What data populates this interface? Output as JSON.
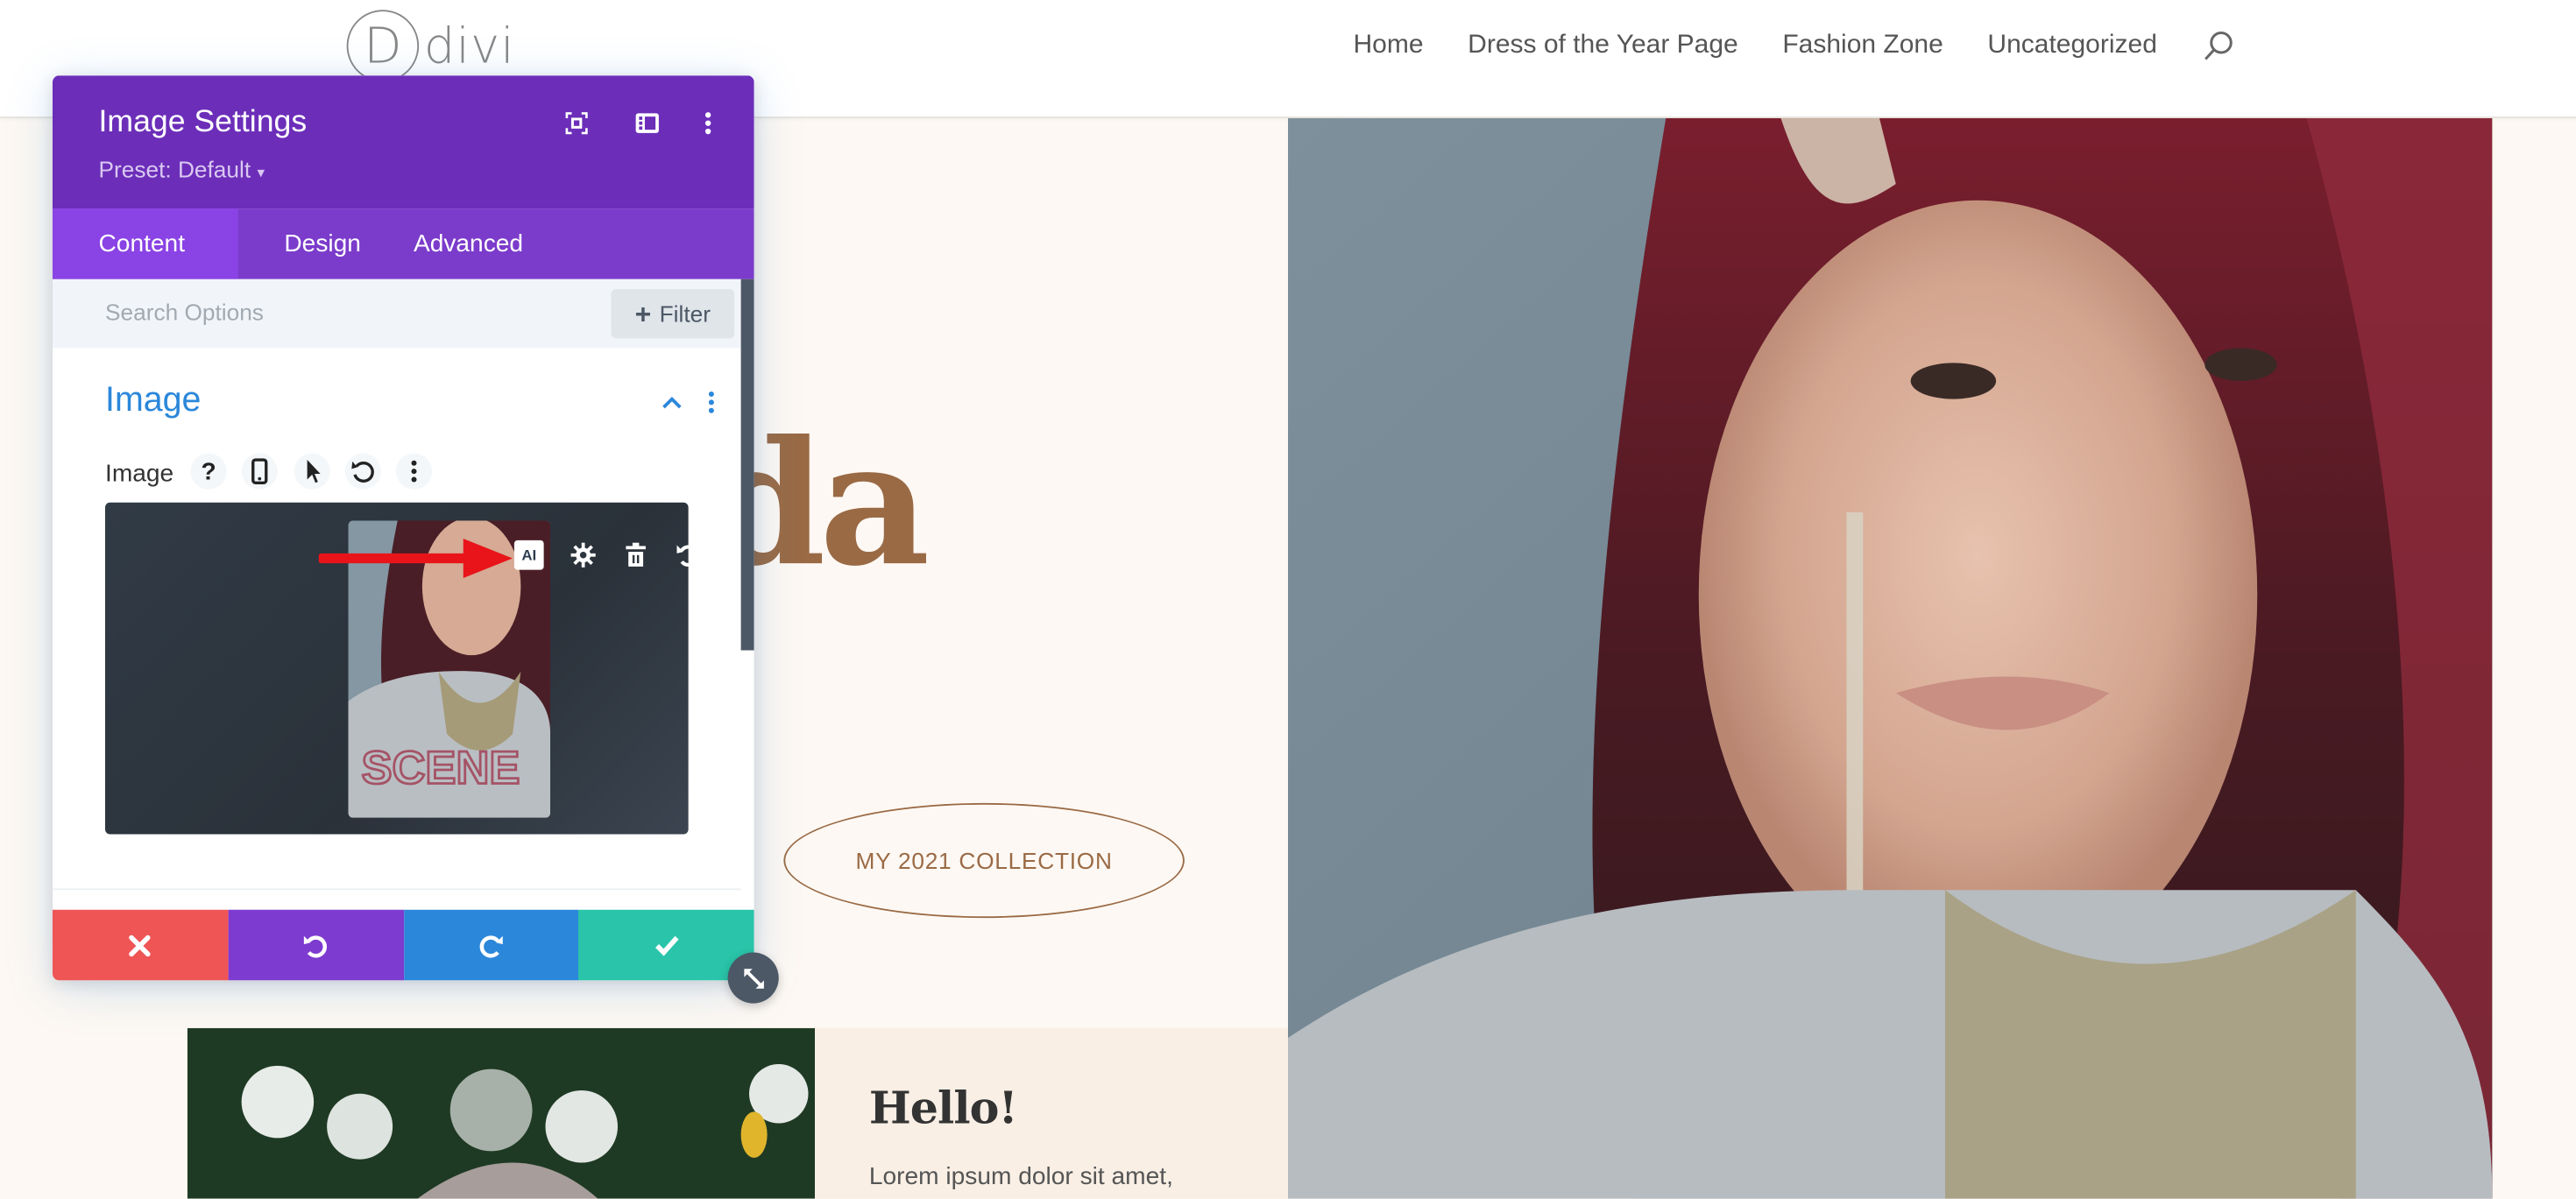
{
  "site": {
    "logo_letter": "D",
    "logo_text": "divi",
    "nav": [
      "Home",
      "Dress of the Year Page",
      "Fashion Zone",
      "Uncategorized"
    ],
    "search_icon": "search-icon"
  },
  "hero": {
    "title_visible": "da",
    "cta_label": "MY 2021 COLLECTION",
    "accent_color": "#9a6a45"
  },
  "about": {
    "title": "Hello!",
    "text": "Lorem ipsum dolor sit amet,"
  },
  "panel": {
    "title": "Image Settings",
    "preset": "Preset: Default",
    "header_icons": [
      "focus-icon",
      "sidebar-layout-icon",
      "more-vertical-icon"
    ],
    "tabs": [
      {
        "label": "Content",
        "active": true
      },
      {
        "label": "Design",
        "active": false
      },
      {
        "label": "Advanced",
        "active": false
      }
    ],
    "search_placeholder": "Search Options",
    "filter_label": "Filter",
    "section_title": "Image",
    "field_label": "Image",
    "field_icons": [
      "help-icon",
      "mobile-icon",
      "cursor-icon",
      "reset-icon",
      "more-vertical-icon"
    ],
    "image_tools": {
      "ai_label": "AI",
      "icons": [
        "ai-icon",
        "gear-icon",
        "trash-icon",
        "undo-icon"
      ]
    },
    "footer": [
      {
        "name": "cancel",
        "icon": "close-icon",
        "color": "#ef5555"
      },
      {
        "name": "undo",
        "icon": "undo-icon",
        "color": "#7e3bd0"
      },
      {
        "name": "redo",
        "icon": "redo-icon",
        "color": "#2b87da"
      },
      {
        "name": "save",
        "icon": "check-icon",
        "color": "#29c4a9"
      }
    ],
    "colors": {
      "header": "#6c2eb9",
      "tabs": "#7b3bcb",
      "active_tab": "#8a43e4",
      "section_title": "#2b87da"
    }
  },
  "annotation": {
    "arrow_color": "#e8141a",
    "points_to": "AI button"
  }
}
